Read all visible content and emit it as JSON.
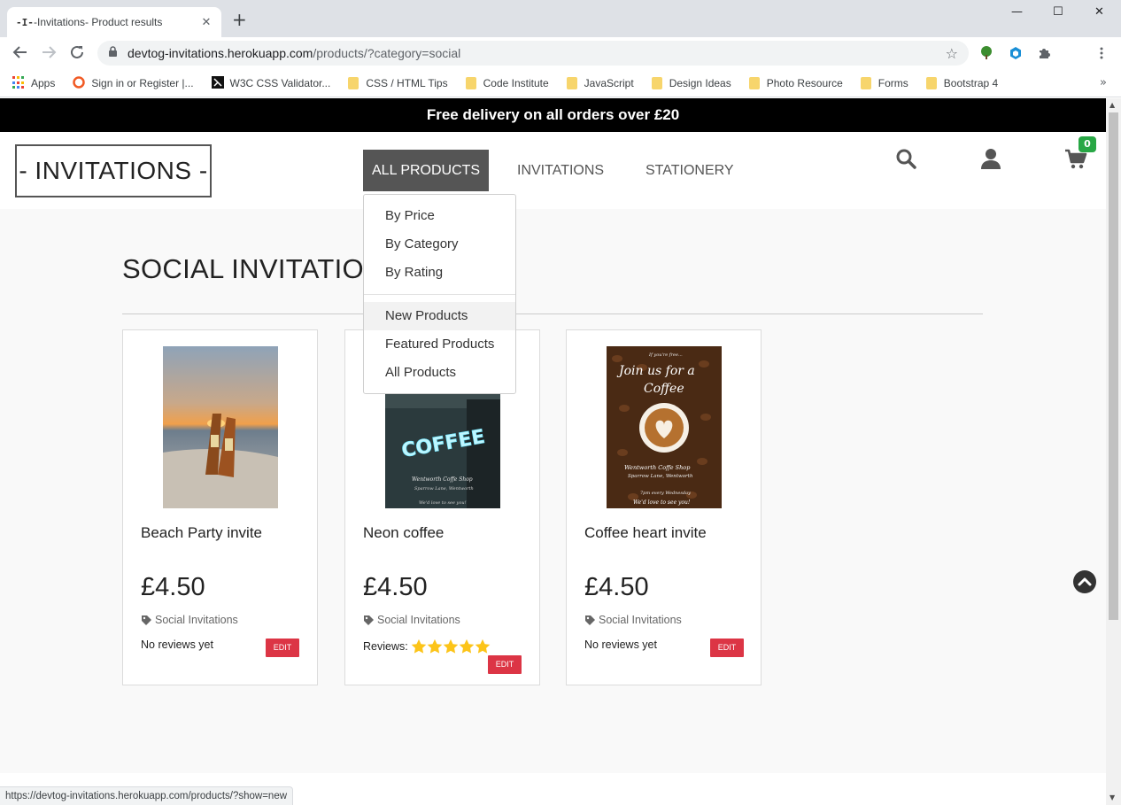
{
  "browser": {
    "tab_favicon": "-I-",
    "tab_title": "-Invitations- Product results",
    "new_tab_label": "+",
    "url_domain": "devtog-invitations.herokuapp.com",
    "url_path": "/products/?category=social",
    "bookmarks": [
      {
        "label": "Apps",
        "icon": "apps-grid-icon"
      },
      {
        "label": "Sign in or Register |...",
        "icon": "opera-icon"
      },
      {
        "label": "W3C CSS Validator...",
        "icon": "w3c-icon"
      },
      {
        "label": "CSS / HTML Tips",
        "icon": "folder-icon"
      },
      {
        "label": "Code Institute",
        "icon": "folder-icon"
      },
      {
        "label": "JavaScript",
        "icon": "folder-icon"
      },
      {
        "label": "Design Ideas",
        "icon": "folder-icon"
      },
      {
        "label": "Photo Resource",
        "icon": "folder-icon"
      },
      {
        "label": "Forms",
        "icon": "folder-icon"
      },
      {
        "label": "Bootstrap 4",
        "icon": "folder-icon"
      }
    ],
    "status_url": "https://devtog-invitations.herokuapp.com/products/?show=new"
  },
  "site": {
    "banner": "Free delivery on all orders over £20",
    "logo": "- INVITATIONS -",
    "nav": [
      {
        "label": "ALL PRODUCTS",
        "active": true
      },
      {
        "label": "INVITATIONS",
        "active": false
      },
      {
        "label": "STATIONERY",
        "active": false
      }
    ],
    "cart_count": "0",
    "dropdown": {
      "group1": [
        "By Price",
        "By Category",
        "By Rating"
      ],
      "group2": [
        "New Products",
        "Featured Products",
        "All Products"
      ],
      "hovered": "New Products"
    },
    "page_title": "SOCIAL INVITATIONS",
    "products": [
      {
        "name": "Beach Party invite",
        "price": "£4.50",
        "category": "Social Invitations",
        "reviews_text": "No reviews yet",
        "rating": null,
        "edit_label": "EDIT"
      },
      {
        "name": "Neon coffee",
        "price": "£4.50",
        "category": "Social Invitations",
        "reviews_text": "Reviews:",
        "rating": 5,
        "edit_label": "EDIT",
        "image_text": {
          "neon": "COFFEE",
          "line1": "Wentworth Coffe Shop",
          "line2": "Sparrow Lane, Wentworth",
          "line3": "We'd love to see you!"
        }
      },
      {
        "name": "Coffee heart invite",
        "price": "£4.50",
        "category": "Social Invitations",
        "reviews_text": "No reviews yet",
        "rating": null,
        "edit_label": "EDIT",
        "image_text": {
          "top": "If you're free...",
          "heading1": "Join us for a",
          "heading2": "Coffee",
          "line1": "Wentworth Coffe Shop",
          "line2": "Sparrow Lane, Wentworth",
          "line3": "7pm every Wednesday",
          "line4": "We'd love to see you!"
        }
      }
    ]
  },
  "colors": {
    "banner_bg": "#000000",
    "nav_active_bg": "#555555",
    "edit_button": "#dc3545",
    "cart_badge": "#28a745",
    "star": "#fcc419"
  }
}
